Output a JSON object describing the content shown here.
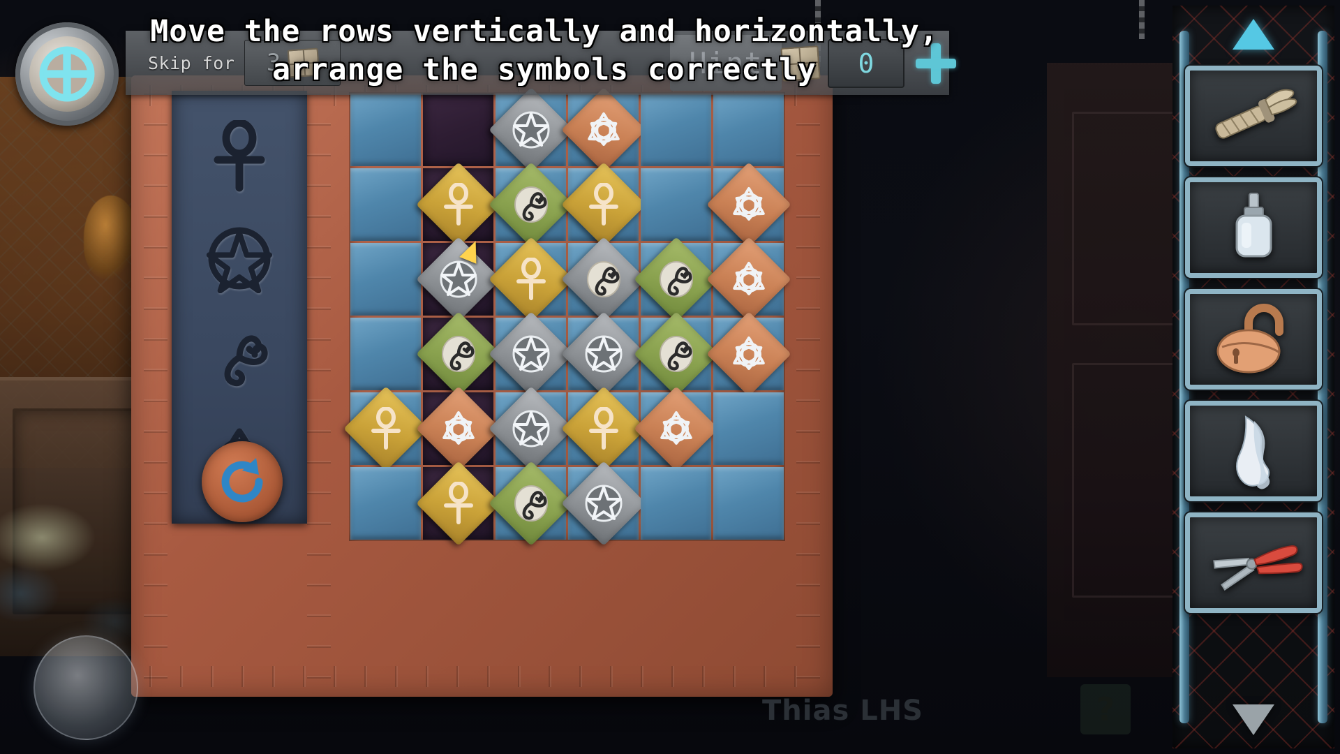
{
  "hud": {
    "skip_label": "Skip for",
    "skip_ticket_count": "3",
    "hint_label": "Hint",
    "coin_count": "0",
    "plus_label": "+",
    "gear_icon": "gear-icon"
  },
  "instruction": {
    "line1": "Move the rows vertically and horizontally,",
    "line2": "arrange the symbols correctly"
  },
  "legend": {
    "symbols": [
      {
        "name": "ankh",
        "label": "Ankh"
      },
      {
        "name": "pentagram",
        "label": "Pentagram"
      },
      {
        "name": "triskelion",
        "label": "Triskelion"
      },
      {
        "name": "triquetra",
        "label": "Triquetra"
      }
    ],
    "reset_icon": "reset-arrow-icon"
  },
  "board": {
    "rows": 6,
    "cols": 6,
    "highlighted_column": 1,
    "cursor_cell": {
      "row": 2,
      "col": 1
    },
    "cells": [
      [
        null,
        null,
        {
          "symbol": "pentagram",
          "color": "silver"
        },
        {
          "symbol": "triquetra",
          "color": "copper"
        },
        null,
        null
      ],
      [
        null,
        {
          "symbol": "ankh",
          "color": "gold"
        },
        {
          "symbol": "triskelion",
          "color": "green"
        },
        {
          "symbol": "ankh",
          "color": "gold"
        },
        null,
        {
          "symbol": "triquetra",
          "color": "copper"
        }
      ],
      [
        null,
        {
          "symbol": "pentagram",
          "color": "silver"
        },
        {
          "symbol": "ankh",
          "color": "gold"
        },
        {
          "symbol": "triskelion",
          "color": "silver"
        },
        {
          "symbol": "triskelion",
          "color": "green"
        },
        {
          "symbol": "triquetra",
          "color": "copper"
        }
      ],
      [
        null,
        {
          "symbol": "triskelion",
          "color": "green"
        },
        {
          "symbol": "pentagram",
          "color": "silver"
        },
        {
          "symbol": "pentagram",
          "color": "silver"
        },
        {
          "symbol": "triskelion",
          "color": "green"
        },
        {
          "symbol": "triquetra",
          "color": "copper"
        }
      ],
      [
        {
          "symbol": "ankh",
          "color": "gold"
        },
        {
          "symbol": "triquetra",
          "color": "copper"
        },
        {
          "symbol": "pentagram",
          "color": "silver"
        },
        {
          "symbol": "ankh",
          "color": "gold"
        },
        {
          "symbol": "triquetra",
          "color": "copper"
        },
        null
      ],
      [
        null,
        {
          "symbol": "ankh",
          "color": "gold"
        },
        {
          "symbol": "triskelion",
          "color": "green"
        },
        {
          "symbol": "pentagram",
          "color": "silver"
        },
        null,
        null
      ]
    ]
  },
  "inventory": {
    "scroll_up_icon": "triangle-up-icon",
    "scroll_down_icon": "triangle-down-icon",
    "items": [
      {
        "name": "mummified-arm",
        "label": "Mummified Arm"
      },
      {
        "name": "glue-bottle",
        "label": "Glue Bottle"
      },
      {
        "name": "padlock",
        "label": "Padlock"
      },
      {
        "name": "broken-shard",
        "label": "Broken Shard"
      },
      {
        "name": "pliers",
        "label": "Pliers"
      }
    ]
  },
  "footer": {
    "watermark": "Thias LHS",
    "help_label": "?"
  },
  "colors": {
    "accent_cyan": "#5ec6d6",
    "frame_copper": "#b4654c",
    "tile_blue": "#4f86ab",
    "gold": "#caa238",
    "green": "#8aa24f",
    "silver": "#8f9397",
    "copper": "#ca8155"
  }
}
